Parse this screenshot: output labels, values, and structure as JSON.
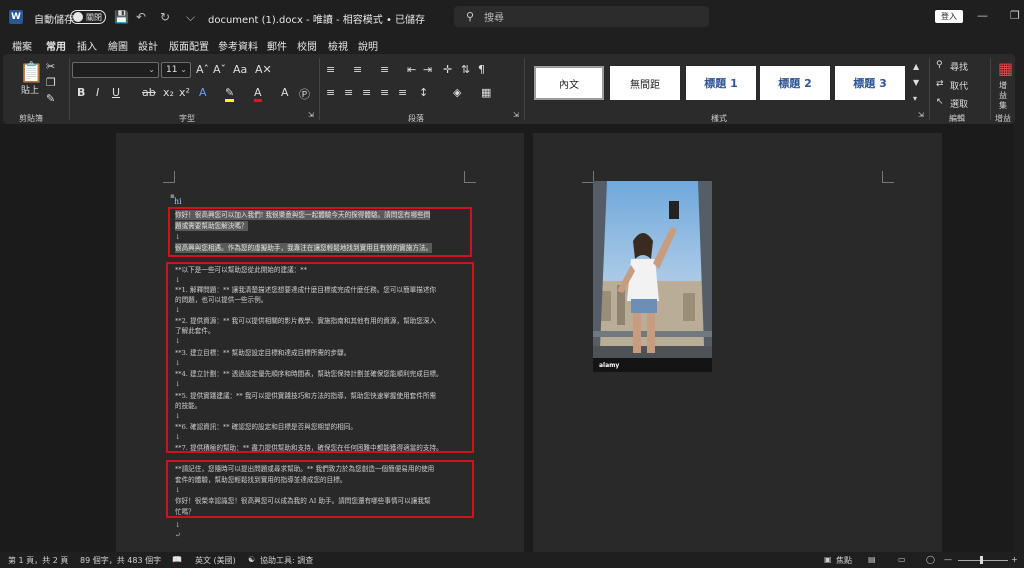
{
  "titlebar": {
    "logo": "W",
    "autosave_label": "自動儲存",
    "autosave_state": "關閉",
    "doc_title": "document (1).docx  -  唯讀  -  相容模式 • 已儲存",
    "search_placeholder": "搜尋",
    "signin_label": "登入"
  },
  "tabs": [
    {
      "label": "檔案"
    },
    {
      "label": "常用"
    },
    {
      "label": "插入"
    },
    {
      "label": "繪圖"
    },
    {
      "label": "設計"
    },
    {
      "label": "版面配置"
    },
    {
      "label": "參考資料"
    },
    {
      "label": "郵件"
    },
    {
      "label": "校閱"
    },
    {
      "label": "檢視"
    },
    {
      "label": "說明"
    }
  ],
  "ribbon": {
    "clipboard": {
      "paste_label": "貼上",
      "group_label": "剪貼簿"
    },
    "font": {
      "size": "11",
      "group_label": "字型"
    },
    "paragraph": {
      "group_label": "段落"
    },
    "styles": {
      "items": [
        "內文",
        "無間距",
        "標題 1",
        "標題 2",
        "標題 3"
      ],
      "group_label": "樣式"
    },
    "editing": {
      "find": "尋找",
      "replace": "取代",
      "select": "選取",
      "group_label": "編輯"
    },
    "addins": {
      "label": "增益集",
      "group_label": "增益集"
    }
  },
  "document": {
    "line_hi": "hi",
    "box1": [
      "你好！很高興您可以加入我們! 我很樂意與您一起體驗今天的探得體驗。請問您有哪些問",
      "題或需要幫助您解決嗎？",
      "",
      "很高興與您相遇。作為您的虛擬助手，我專注在讓您輕鬆地找到實用且有效的實施方法。"
    ],
    "box2": [
      "**以下是一些可以幫助您從此開始的建議：**",
      "",
      "**1. 解釋問題：** 讓我清楚描述您想要達成什麼目標或完成什麼任務。您可以簡單描述你",
      "的問題，也可以提供一些示例。",
      "",
      "**2. 提供資源：** 我可以提供相關的影片教學、實施指南和其他有用的資源，幫助您深入",
      "了解此套件。",
      "",
      "**3. 建立目標：** 幫助您設定目標和達成目標所需的步驟。",
      "",
      "**4. 建立計劃：** 透過設定優先順序和時間表，幫助您保持計劃並確保您能順利完成目標。",
      "",
      "**5. 提供實踐建議：** 我可以提供實踐技巧和方法的指導，幫助您快速掌握使用套件所需",
      "的技能。",
      "",
      "**6. 確認資訊：** 確認您的設定和目標是否與您期望的相同。",
      "",
      "**7. 提供積極的幫助：** 盡力提供幫助和支持，確保您在任何困難中都能獲得適當的支持。"
    ],
    "box3": [
      "**請記住，您隨時可以提出問題或尋求幫助。** 我們致力於為您創造一個簡便易用的使用",
      "套件的體驗，幫助您輕鬆找到實用的指導並達成您的目標。",
      "",
      "你好！很榮幸認識您！很高興您可以成為我的 AI 助手。請問您還有哪些事情可以讓我幫",
      "忙嗎？"
    ],
    "image_watermark": "alamy"
  },
  "statusbar": {
    "page": "第 1 頁，共 2 頁",
    "words": "89 個字，共 483 個字",
    "language": "英文 (美國)",
    "accessibility": "協助工具: 調查",
    "focus": "焦點"
  },
  "colors": {
    "background": "#1f1f1f",
    "ribbon": "#2b2b2b",
    "page": "#292929",
    "highlight_box": "#d0121b",
    "heading_blue": "#2e5597"
  }
}
